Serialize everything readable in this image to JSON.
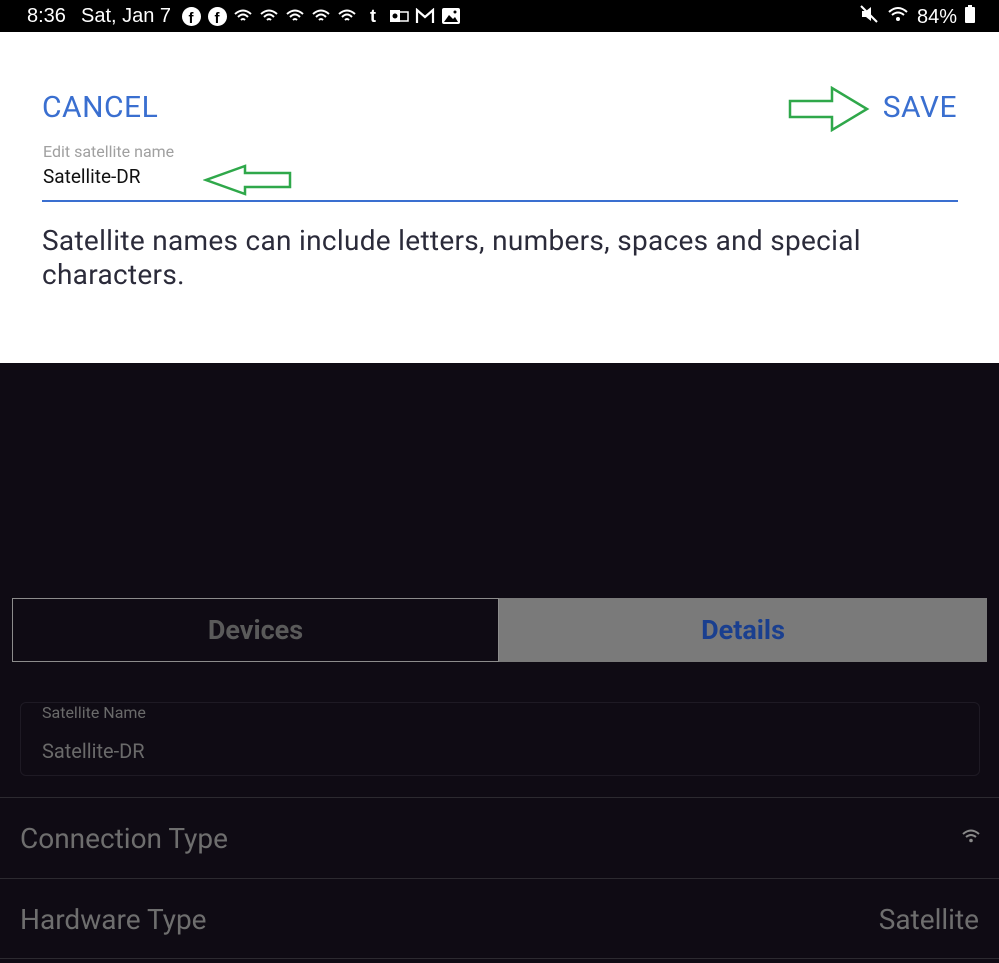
{
  "status_bar": {
    "time": "8:36",
    "date": "Sat, Jan 7",
    "battery": "84%",
    "notification_icons": [
      "facebook-icon",
      "facebook-icon",
      "wifi-icon",
      "wifi-icon",
      "wifi-icon",
      "wifi-icon",
      "wifi-icon",
      "tumblr-icon",
      "outlook-icon",
      "gmail-icon",
      "gallery-icon"
    ],
    "system_icons": [
      "mute-icon",
      "wifi-icon",
      "battery-icon"
    ]
  },
  "dialog": {
    "cancel_label": "CANCEL",
    "save_label": "SAVE",
    "field_label": "Edit satellite name",
    "field_value": "Satellite-DR",
    "helper_text": "Satellite names can include letters, numbers, spaces and special characters."
  },
  "tabs": [
    {
      "label": "Devices",
      "active": false
    },
    {
      "label": "Details",
      "active": true
    }
  ],
  "details": {
    "satellite_name_label": "Satellite Name",
    "satellite_name_value": "Satellite-DR",
    "connection_type_label": "Connection Type",
    "connection_type_icon": "wifi-icon",
    "hardware_type_label": "Hardware Type",
    "hardware_type_value": "Satellite"
  },
  "colors": {
    "accent": "#3a6fd0",
    "annotation_arrow": "#2fa84a",
    "background": "#0f0b14"
  }
}
